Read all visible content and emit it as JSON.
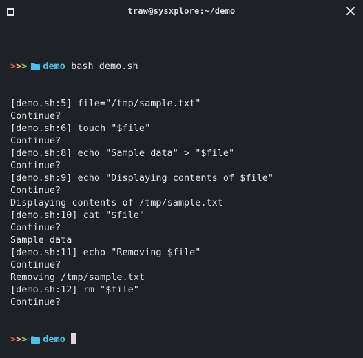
{
  "window": {
    "title": "traw@sysxplore:~/demo"
  },
  "colors": {
    "background": "#1e2226",
    "text": "#e1e1e1",
    "arrow1": "#e05561",
    "arrow2": "#e5c07b",
    "arrow3": "#98c379",
    "directory": "#4fc1e9"
  },
  "prompt": {
    "symbols": [
      ">",
      ">",
      ">"
    ],
    "folder_icon": "folder-icon",
    "dir": "demo",
    "command": "bash demo.sh"
  },
  "output": [
    "[demo.sh:5] file=\"/tmp/sample.txt\"",
    "Continue?",
    "[demo.sh:6] touch \"$file\"",
    "Continue?",
    "[demo.sh:8] echo \"Sample data\" > \"$file\"",
    "Continue?",
    "[demo.sh:9] echo \"Displaying contents of $file\"",
    "Continue?",
    "Displaying contents of /tmp/sample.txt",
    "[demo.sh:10] cat \"$file\"",
    "Continue?",
    "Sample data",
    "[demo.sh:11] echo \"Removing $file\"",
    "Continue?",
    "Removing /tmp/sample.txt",
    "[demo.sh:12] rm \"$file\"",
    "Continue?"
  ],
  "final_prompt": {
    "dir": "demo"
  }
}
